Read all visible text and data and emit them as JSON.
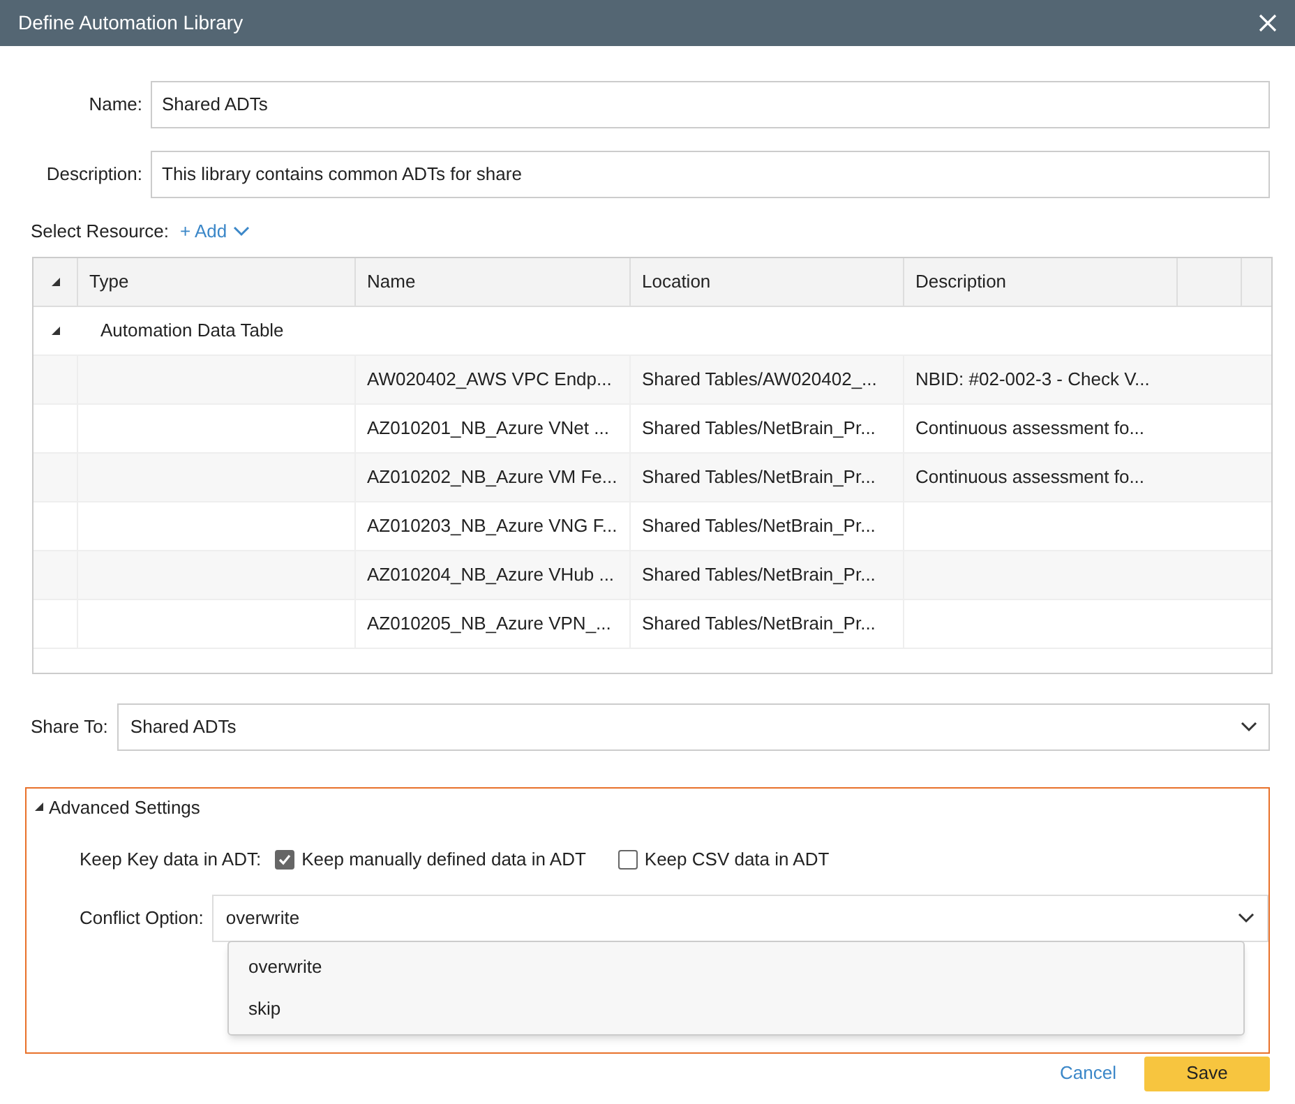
{
  "window": {
    "title": "Define Automation Library"
  },
  "name_field": {
    "label": "Name:",
    "value": "Shared ADTs"
  },
  "description_field": {
    "label": "Description:",
    "value": "This library contains common ADTs for share"
  },
  "select_resource": {
    "label": "Select Resource:",
    "add_link": "+ Add"
  },
  "table": {
    "columns": [
      "Type",
      "Name",
      "Location",
      "Description"
    ],
    "group": {
      "label": "Automation Data Table",
      "expanded": true
    },
    "rows": [
      {
        "name": "AW020402_AWS VPC Endp...",
        "location": "Shared Tables/AW020402_...",
        "description": "NBID: #02-002-3 - Check V..."
      },
      {
        "name": "AZ010201_NB_Azure VNet ...",
        "location": "Shared Tables/NetBrain_Pr...",
        "description": "Continuous assessment fo..."
      },
      {
        "name": "AZ010202_NB_Azure VM Fe...",
        "location": "Shared Tables/NetBrain_Pr...",
        "description": "Continuous assessment fo..."
      },
      {
        "name": "AZ010203_NB_Azure VNG F...",
        "location": "Shared Tables/NetBrain_Pr..."
      },
      {
        "name": "AZ010204_NB_Azure VHub ...",
        "location": "Shared Tables/NetBrain_Pr..."
      },
      {
        "name": "AZ010205_NB_Azure VPN_...",
        "location": "Shared Tables/NetBrain_Pr..."
      }
    ]
  },
  "share_to": {
    "label": "Share To:",
    "value": "Shared ADTs"
  },
  "advanced": {
    "label": "Advanced Settings",
    "expanded": true,
    "keep_key": {
      "label": "Keep Key data in ADT:",
      "options": [
        {
          "label": "Keep manually defined data in ADT",
          "checked": true
        },
        {
          "label": "Keep CSV data in ADT",
          "checked": false
        }
      ]
    },
    "conflict": {
      "label": "Conflict Option:",
      "value": "overwrite",
      "open": true,
      "options": [
        "overwrite",
        "skip"
      ]
    }
  },
  "buttons": [
    "Cancel",
    "Save"
  ]
}
